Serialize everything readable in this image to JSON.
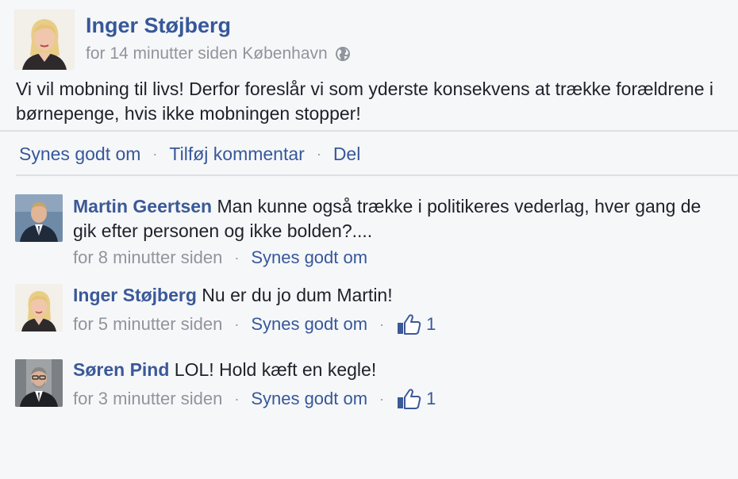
{
  "post": {
    "author": "Inger Støjberg",
    "time": "for 14 minutter siden",
    "location": "København",
    "text": "Vi vil mobning til livs! Derfor foreslår vi som yderste konsekvens at trække forældrene i børnepenge, hvis ikke mobningen stopper!",
    "privacy_icon": "globe-icon"
  },
  "actions": {
    "like": "Synes godt om",
    "comment": "Tilføj kommentar",
    "share": "Del",
    "separator": "·"
  },
  "comments": [
    {
      "author": "Martin Geertsen",
      "text": "Man kunne også trække i politikeres vederlag, hver gang de gik efter personen og ikke bolden?....",
      "time": "for 8 minutter siden",
      "like_label": "Synes godt om"
    },
    {
      "author": "Inger Støjberg",
      "text": "Nu er du jo dum Martin!",
      "time": "for 5 minutter siden",
      "like_label": "Synes godt om",
      "likes": "1"
    },
    {
      "author": "Søren Pind",
      "text": "LOL! Hold kæft en kegle!",
      "time": "for 3 minutter siden",
      "like_label": "Synes godt om",
      "likes": "1"
    }
  ],
  "colors": {
    "name_blue": "#3b5998",
    "link_blue": "#365899",
    "meta_gray": "#90949c",
    "text": "#1d2129",
    "background": "#f6f7f9"
  }
}
